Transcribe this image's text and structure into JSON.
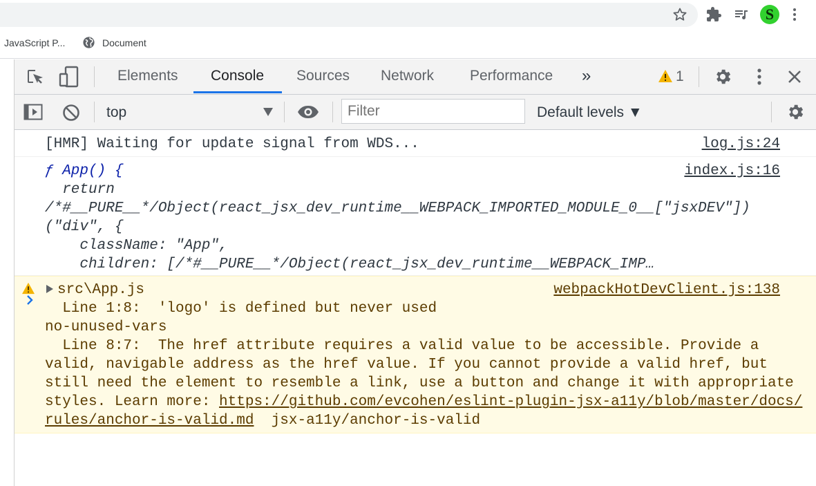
{
  "browser": {
    "profile_initial": "S",
    "bookmarks": [
      {
        "label": "JavaScript P...",
        "icon": "bookmark-favicon"
      },
      {
        "label": "Document",
        "icon": "globe-icon"
      }
    ]
  },
  "devtools": {
    "tabs": [
      "Elements",
      "Console",
      "Sources",
      "Network",
      "Performance"
    ],
    "active_tab": "Console",
    "more_tabs": "»",
    "warning_count": "1",
    "console_toolbar": {
      "context": "top",
      "filter_placeholder": "Filter",
      "levels": "Default levels"
    },
    "accent_color": "#1a73e8",
    "warning_bg": "#fffbe5"
  },
  "console": {
    "messages": [
      {
        "text": "[HMR] Waiting for update signal from WDS...",
        "source": "log.js:24"
      },
      {
        "lines": [
          "ƒ App() {",
          "  return",
          "/*#__PURE__*/Object(react_jsx_dev_runtime__WEBPACK_IMPORTED_MODULE_0__[\"jsxDEV\"])",
          "(\"div\", {",
          "    className: \"App\",",
          "    children: [/*#__PURE__*/Object(react_jsx_dev_runtime__WEBPACK_IMP…"
        ],
        "source": "index.js:16"
      },
      {
        "level": "warning",
        "title": "src\\App.js",
        "lines": [
          "  Line 1:8:  'logo' is defined but never used",
          "no-unused-vars",
          "  Line 8:7:  The href attribute requires a valid value to be accessible. Provide a",
          "valid, navigable address as the href value. If you cannot provide a valid href, but",
          "still need the element to resemble a link, use a button and change it with appropriate",
          "styles. Learn more: "
        ],
        "link_part1": "https://github.com/evcohen/eslint-plugin-jsx-a11y/blob/master/docs/",
        "link_part2": "rules/anchor-is-valid.md",
        "rule": "  jsx-a11y/anchor-is-valid",
        "source": "webpackHotDevClient.js:138"
      }
    ]
  }
}
